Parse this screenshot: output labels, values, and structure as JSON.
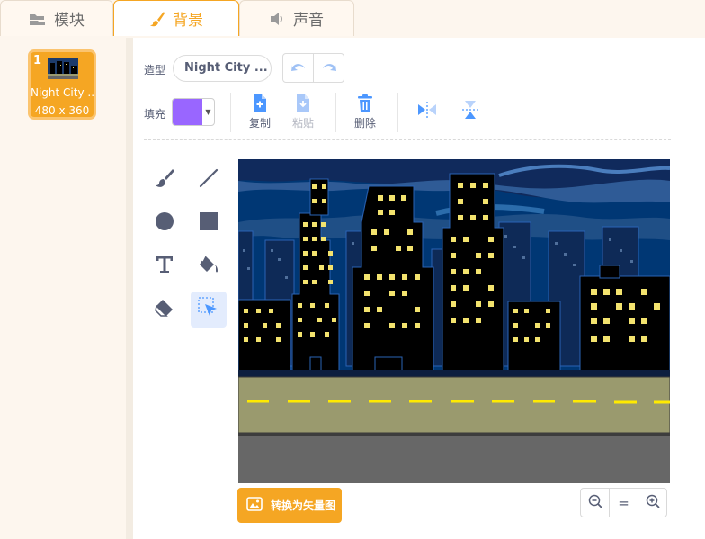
{
  "tabs": [
    {
      "label": "模块",
      "icon": "code-blocks-icon"
    },
    {
      "label": "背景",
      "icon": "paintbrush-icon"
    },
    {
      "label": "声音",
      "icon": "speaker-icon"
    }
  ],
  "backdrops": [
    {
      "number": "1",
      "name": "Night City ...",
      "size": "480 x 360"
    }
  ],
  "editor": {
    "costume_label": "造型",
    "costume_name": "Night City ...",
    "fill_label": "填充",
    "fill_color": "#9966ff",
    "actions": {
      "copy": "复制",
      "paste": "粘贴",
      "delete": "删除"
    },
    "convert_label": "转换为矢量图",
    "zoom_reset_label": "="
  },
  "colors": {
    "accent": "#f5a623",
    "icon_blue": "#4c97ff",
    "tool_gray": "#575e75"
  }
}
